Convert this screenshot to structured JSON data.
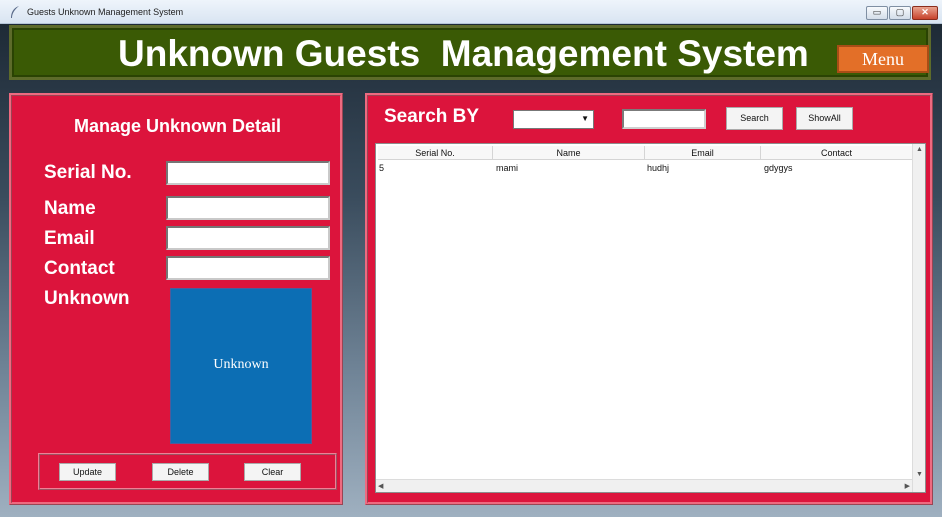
{
  "window": {
    "title": "Guests Unknown Management System",
    "minimize": "▭",
    "maximize": "▢",
    "close": "✕"
  },
  "header": {
    "title": "Unknown Guests  Management System",
    "menu_label": "Menu"
  },
  "manage": {
    "title": "Manage Unknown Detail",
    "fields": [
      {
        "label": "Serial No.",
        "value": ""
      },
      {
        "label": "Name",
        "value": ""
      },
      {
        "label": "Email",
        "value": ""
      },
      {
        "label": "Contact",
        "value": ""
      }
    ],
    "unknown_label": "Unknown",
    "unknown_image_text": "Unknown",
    "buttons": {
      "update": "Update",
      "delete": "Delete",
      "clear": "Clear"
    }
  },
  "search": {
    "title": "Search BY",
    "select_value": "",
    "query": "",
    "search_button": "Search",
    "show_all_button": "ShowAll"
  },
  "table": {
    "columns": [
      "Serial No.",
      "Name",
      "Email",
      "Contact"
    ],
    "rows": [
      [
        "5",
        "mami",
        "hudhj",
        "gdygys"
      ]
    ]
  },
  "colors": {
    "header_bg": "#3a5a05",
    "panel_bg": "#dc143c",
    "menu_button": "#e36f28",
    "unknown_box": "#0c6eb4"
  }
}
